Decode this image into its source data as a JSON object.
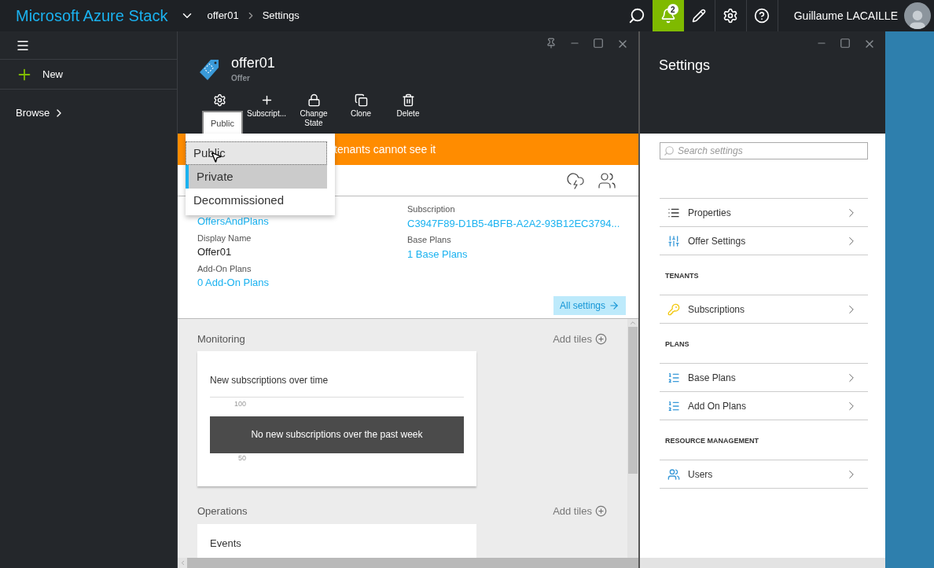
{
  "topbar": {
    "title": "Microsoft Azure Stack",
    "breadcrumb": [
      "offer01",
      "Settings"
    ],
    "notifications": "2",
    "user": "Guillaume LACAILLE"
  },
  "sidebar": {
    "items": [
      {
        "kind": "new",
        "label": "New"
      },
      {
        "kind": "browse",
        "label": "Browse"
      }
    ]
  },
  "offer_blade": {
    "title": "offer01",
    "subtitle": "Offer",
    "commands": [
      {
        "kind": "gear"
      },
      {
        "kind": "plus",
        "label": "Subscript..."
      },
      {
        "kind": "lock",
        "label": "Change State"
      },
      {
        "kind": "clone",
        "label": "Clone"
      },
      {
        "kind": "trash",
        "label": "Delete"
      }
    ],
    "tooltip": "Public",
    "state_menu": [
      {
        "label": "Public",
        "selected": false,
        "focused": true
      },
      {
        "label": "Private",
        "selected": true,
        "focused": false
      },
      {
        "label": "Decommissioned",
        "selected": false,
        "focused": false
      }
    ],
    "banner": "tenants cannot see it",
    "essentials": {
      "left": [
        {
          "value": "OffersAndPlans",
          "link": true
        },
        {
          "label": "Display Name",
          "value": "Offer01",
          "link": false
        },
        {
          "label": "Add-On Plans",
          "value": "0 Add-On Plans",
          "link": true
        }
      ],
      "right": [
        {
          "label": "Subscription",
          "value": "C3947F89-D1B5-4BFB-A2A2-93B12EC3794...",
          "link": true
        },
        {
          "label": "Base Plans",
          "value": "1 Base Plans",
          "link": true
        }
      ]
    },
    "all_settings": "All settings",
    "sections": [
      {
        "title": "Monitoring",
        "add": "Add tiles",
        "tile": {
          "kind": "chart",
          "title": "New subscriptions over time",
          "ticks": [
            "100",
            "50"
          ],
          "message": "No new subscriptions over the past week"
        }
      },
      {
        "title": "Operations",
        "add": "Add tiles",
        "tile": {
          "kind": "events",
          "title": "Events"
        }
      }
    ]
  },
  "settings_blade": {
    "title": "Settings",
    "search": {
      "placeholder": "Search settings"
    },
    "groups": [
      {
        "items": [
          {
            "kind": "list",
            "label": "Properties"
          },
          {
            "kind": "sliders",
            "label": "Offer Settings"
          }
        ]
      },
      {
        "heading": "TENANTS",
        "items": [
          {
            "kind": "key",
            "label": "Subscriptions"
          }
        ]
      },
      {
        "heading": "PLANS",
        "items": [
          {
            "kind": "plans",
            "label": "Base Plans"
          },
          {
            "kind": "plans",
            "label": "Add On Plans"
          }
        ]
      },
      {
        "heading": "RESOURCE MANAGEMENT",
        "items": [
          {
            "kind": "users",
            "label": "Users"
          }
        ]
      }
    ]
  }
}
